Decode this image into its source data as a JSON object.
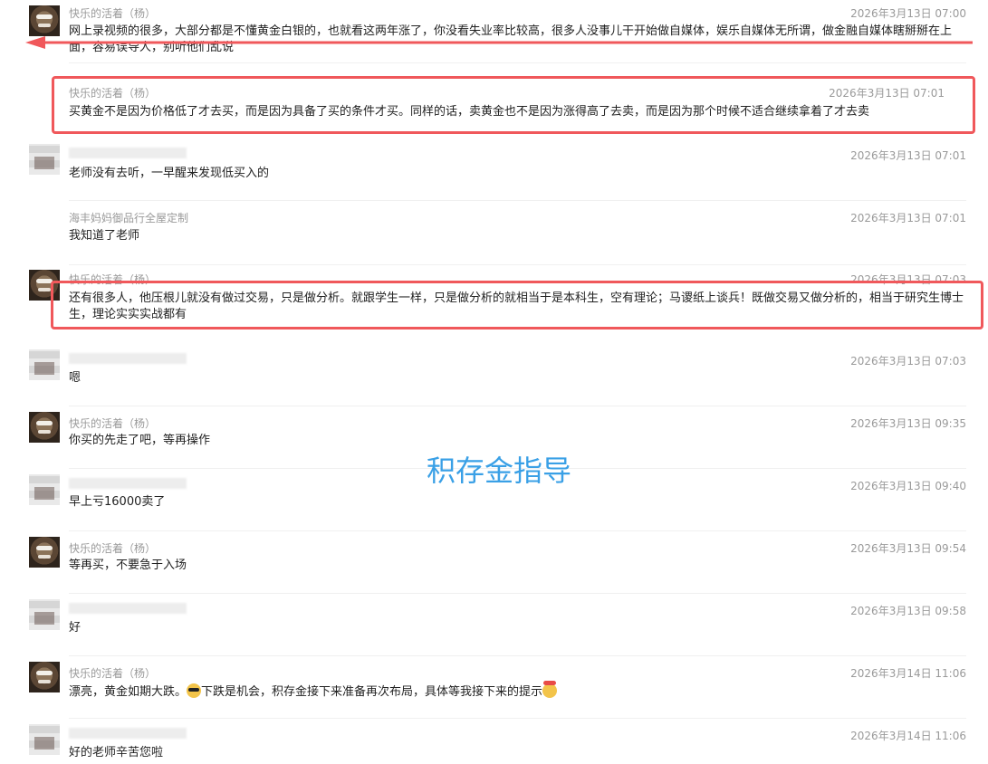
{
  "watermark": "积存金指导",
  "messages": [
    {
      "sender": "快乐的活着（杨）",
      "time": "2026年3月13日 07:00",
      "text": "网上录视频的很多，大部分都是不懂黄金白银的，也就看这两年涨了，你没看失业率比较高，很多人没事儿干开始做自媒体，娱乐自媒体无所谓，做金融自媒体瞎掰掰在上面，容易误导人，别听他们乱说"
    },
    {
      "sender": "快乐的活着（杨）",
      "time": "2026年3月13日 07:01",
      "text": "买黄金不是因为价格低了才去买，而是因为具备了买的条件才买。同样的话，卖黄金也不是因为涨得高了去卖，而是因为那个时候不适合继续拿着了才去卖"
    },
    {
      "sender": "",
      "time": "2026年3月13日 07:01",
      "text": "老师没有去听，一早醒来发现低买入的"
    },
    {
      "sender": "海丰妈妈御品行全屋定制",
      "time": "2026年3月13日 07:01",
      "text": "我知道了老师"
    },
    {
      "sender": "快乐的活着（杨）",
      "time": "2026年3月13日 07:03",
      "text": "还有很多人，他压根儿就没有做过交易，只是做分析。就跟学生一样，只是做分析的就相当于是本科生，空有理论；马谡纸上谈兵！既做交易又做分析的，相当于研究生博士生，理论实实实战都有"
    },
    {
      "sender": "",
      "time": "2026年3月13日 07:03",
      "text": "嗯"
    },
    {
      "sender": "快乐的活着（杨）",
      "time": "2026年3月13日 09:35",
      "text": "你买的先走了吧，等再操作"
    },
    {
      "sender": "",
      "time": "2026年3月13日 09:40",
      "text": "早上亏16000卖了"
    },
    {
      "sender": "快乐的活着（杨）",
      "time": "2026年3月13日 09:54",
      "text": "等再买，不要急于入场"
    },
    {
      "sender": "",
      "time": "2026年3月13日 09:58",
      "text": "好"
    },
    {
      "sender": "快乐的活着（杨）",
      "time": "2026年3月14日 11:06",
      "text_a": "漂亮，黄金如期大跌。",
      "text_b": "下跌是机会，积存金接下来准备再次布局，具体等我接下来的提示"
    },
    {
      "sender": "",
      "time": "2026年3月14日 11:06",
      "text": "好的老师辛苦您啦"
    }
  ]
}
